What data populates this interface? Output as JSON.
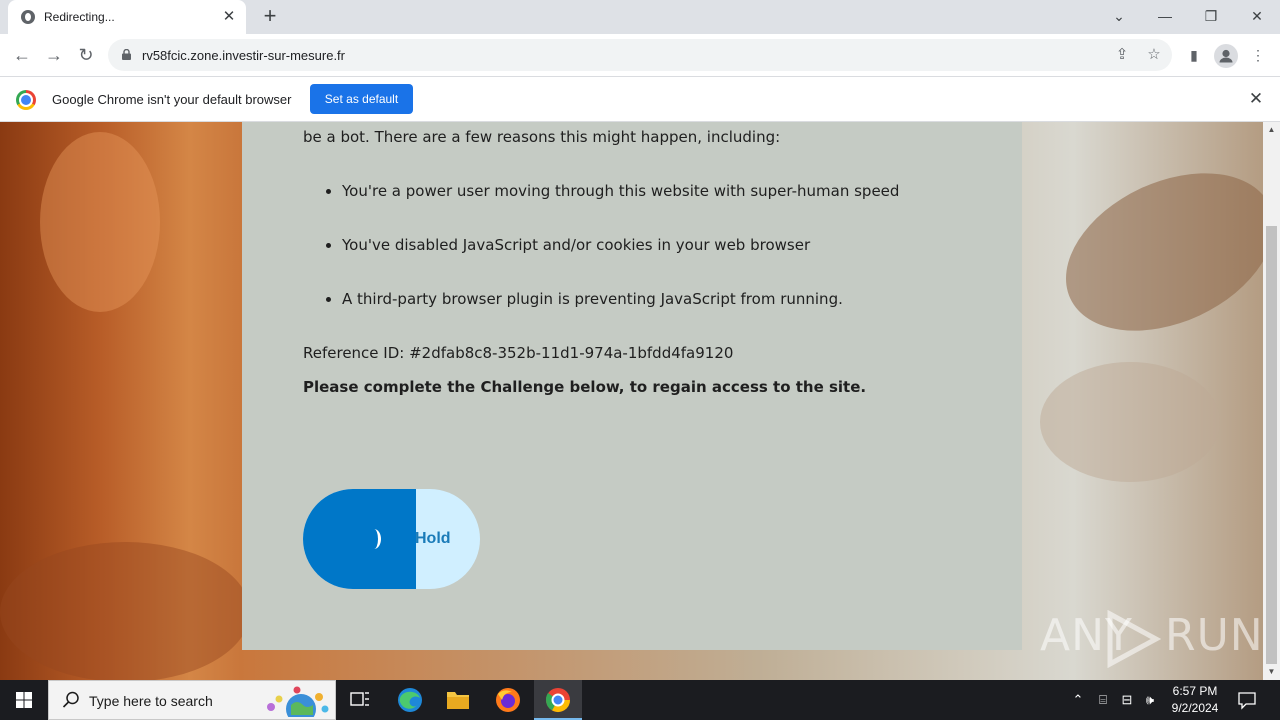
{
  "browser": {
    "tab_title": "Redirecting...",
    "url": "rv58fcic.zone.investir-sur-mesure.fr"
  },
  "infobar": {
    "message": "Google Chrome isn't your default browser",
    "button_label": "Set as default"
  },
  "page": {
    "intro": "be a bot. There are a few reasons this might happen, including:",
    "reasons": [
      "You're a power user moving through this website with super-human speed",
      "You've disabled JavaScript and/or cookies in your web browser",
      "A third-party browser plugin is preventing JavaScript from running."
    ],
    "reference": "Reference ID: #2dfab8c8-352b-11d1-974a-1bfdd4fa9120",
    "instruction": "Please complete the Challenge below, to regain access to the site.",
    "hold_button": {
      "label": "Hold",
      "progress": 0.64
    }
  },
  "watermark": {
    "left": "ANY",
    "right": "RUN"
  },
  "taskbar": {
    "search_placeholder": "Type here to search",
    "time": "6:57 PM",
    "date": "9/2/2024"
  },
  "colors": {
    "accent": "#1a73e8",
    "hold_fill": "#0077c8",
    "hold_track": "#d0efff",
    "card_bg": "#c5cbc4"
  }
}
